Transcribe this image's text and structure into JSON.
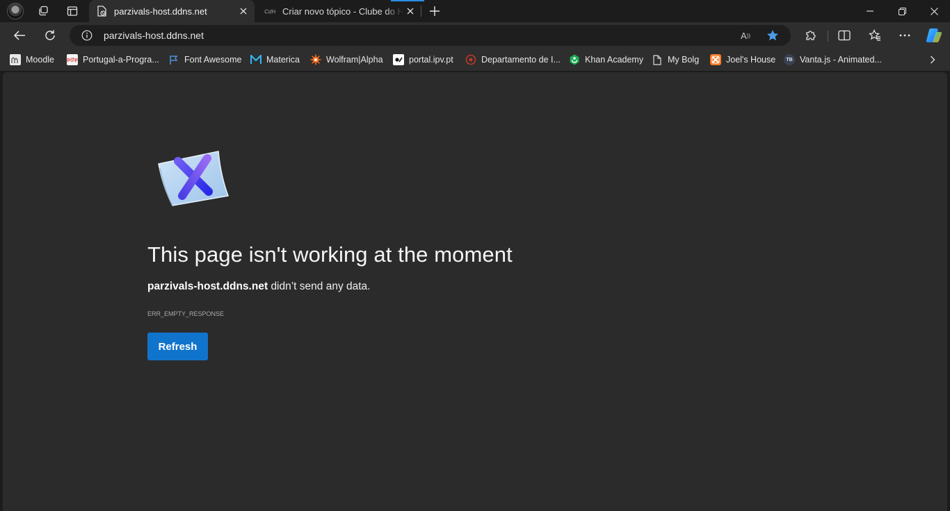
{
  "tabs": [
    {
      "title": "parzivals-host.ddns.net",
      "active": true
    },
    {
      "title": "Criar novo tópico - Clube do Hardware",
      "active": false
    }
  ],
  "address_bar": {
    "url": "parzivals-host.ddns.net",
    "read_aloud_label": "A"
  },
  "bookmarks": [
    {
      "label": "Moodle",
      "icon": "moodle-icon"
    },
    {
      "label": "Portugal-a-Progra...",
      "icon": "pap-icon"
    },
    {
      "label": "Font Awesome",
      "icon": "flag-icon"
    },
    {
      "label": "Materica",
      "icon": "materica-icon"
    },
    {
      "label": "Wolfram|Alpha",
      "icon": "wolfram-icon"
    },
    {
      "label": "portal.ipv.pt",
      "icon": "ipv-icon"
    },
    {
      "label": "Departamento de I...",
      "icon": "departamento-icon"
    },
    {
      "label": "Khan Academy",
      "icon": "khan-icon"
    },
    {
      "label": "My Bolg",
      "icon": "page-icon"
    },
    {
      "label": "Joel's House",
      "icon": "xampp-icon"
    },
    {
      "label": "Vanta.js - Animated...",
      "icon": "tb-icon"
    }
  ],
  "error_page": {
    "title": "This page isn't working at the moment",
    "host": "parzivals-host.ddns.net",
    "message": "didn’t send any data.",
    "code": "ERR_EMPTY_RESPONSE",
    "refresh_label": "Refresh"
  },
  "icon_labels": {
    "tb": "TB",
    "pap": "p@p"
  },
  "colors": {
    "page_background": "#2b2b2b",
    "chrome_background": "#2e2e2e",
    "refresh_button": "#1174cc",
    "favorite_star": "#4a9de8"
  }
}
